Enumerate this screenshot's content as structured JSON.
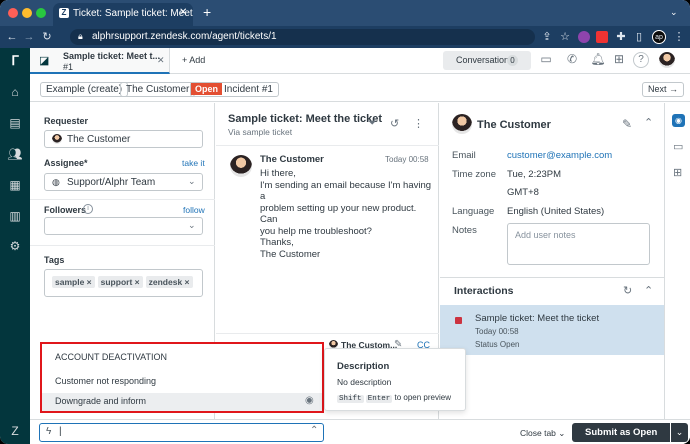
{
  "browser": {
    "tab_title": "Ticket: Sample ticket: Meet the",
    "url": "alphrsupport.zendesk.com/agent/tickets/1"
  },
  "header": {
    "ws_tab_title": "Sample ticket: Meet t...",
    "ws_tab_sub": "#1",
    "add_label": "Add",
    "conversations_label": "Conversations",
    "conversations_count": "0"
  },
  "crumbs": {
    "example": "Example (create)",
    "customer": "The Customer",
    "status": "Open",
    "incident": "Incident #1",
    "next": "Next"
  },
  "left": {
    "requester_label": "Requester",
    "requester_value": "The Customer",
    "assignee_label": "Assignee*",
    "take_it": "take it",
    "assignee_value": "Support/Alphr Team",
    "followers_label": "Followers",
    "follow": "follow",
    "tags_label": "Tags",
    "tags": [
      "sample",
      "support",
      "zendesk"
    ]
  },
  "conversation": {
    "title": "Sample ticket: Meet the ticket",
    "via": "Via sample ticket",
    "author": "The Customer",
    "time": "Today 00:58",
    "body": [
      "Hi there,",
      "I'm sending an email because I'm having a",
      "problem setting up your new product. Can",
      "you help me troubleshoot?",
      "Thanks,",
      "The Customer"
    ],
    "reply_to": "The Custom...",
    "cc": "CC"
  },
  "customer": {
    "name": "The Customer",
    "email_label": "Email",
    "email": "customer@example.com",
    "tz_label": "Time zone",
    "tz_time": "Tue, 2:23PM",
    "tz_offset": "GMT+8",
    "lang_label": "Language",
    "language": "English (United States)",
    "notes_label": "Notes",
    "notes_placeholder": "Add user notes"
  },
  "interactions": {
    "title": "Interactions",
    "item_title": "Sample ticket: Meet the ticket",
    "item_time": "Today 00:58",
    "item_status_label": "Status",
    "item_status": "Open"
  },
  "macros": {
    "items": [
      "ACCOUNT DEACTIVATION",
      "Customer not responding",
      "Downgrade and inform"
    ]
  },
  "description": {
    "title": "Description",
    "body": "No description",
    "hint_key1": "Shift",
    "hint_key2": "Enter",
    "hint_text": "to open preview"
  },
  "bottom": {
    "close_tab": "Close tab",
    "submit": "Submit as Open"
  },
  "colors": {
    "chrome_bg": "#2b4d73",
    "nav_bg": "#03363d",
    "open_badge": "#e34f32",
    "highlight": "#cfe0ee",
    "submit_bg": "#2f3941",
    "red_outline": "#e0161b"
  }
}
